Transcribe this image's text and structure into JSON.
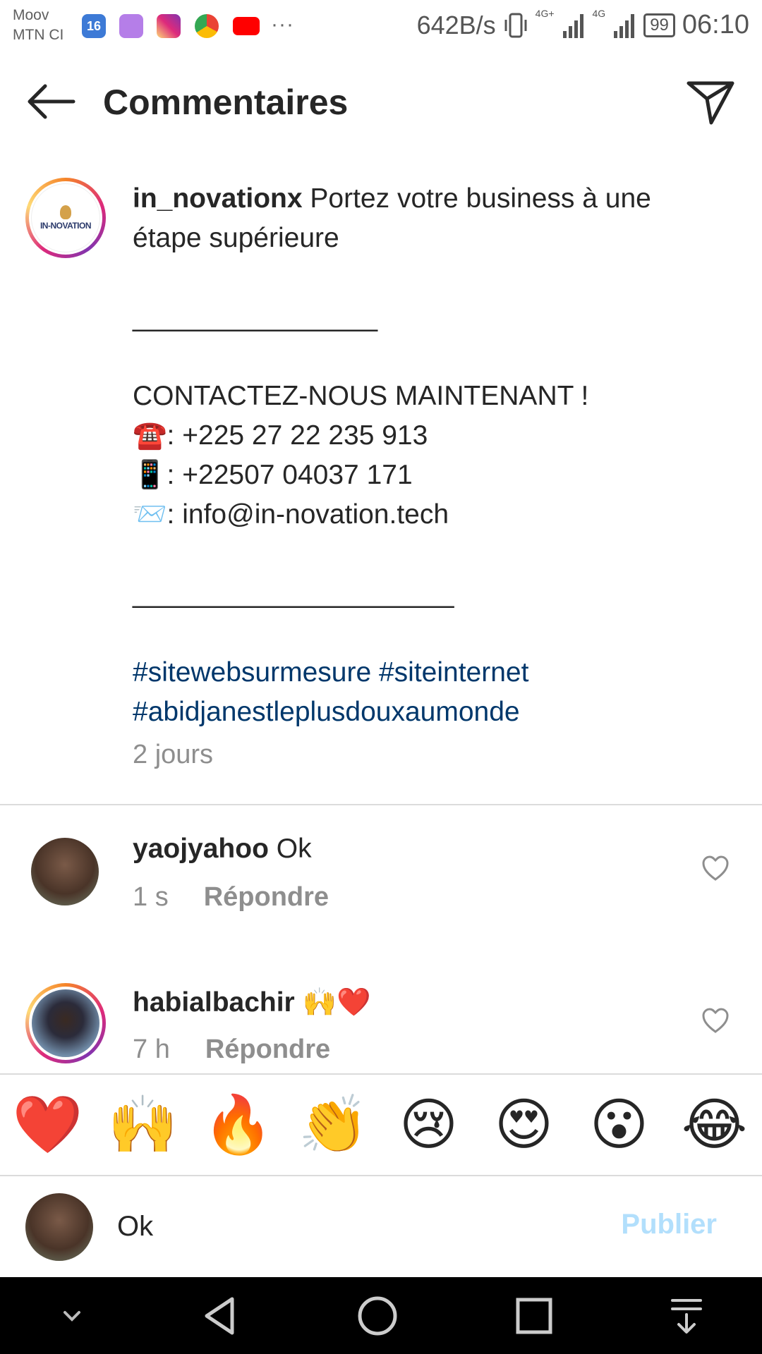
{
  "status_bar": {
    "carrier_1": "Moov",
    "carrier_2": "MTN CI",
    "notif_badge": "16",
    "overflow": "···",
    "speed": "642B/s",
    "net_1": "4G+",
    "net_2": "4G",
    "battery": "99",
    "time": "06:10"
  },
  "header": {
    "title": "Commentaires",
    "back_icon": "arrow-left-icon",
    "share_icon": "paper-plane-icon"
  },
  "post": {
    "username": "in_novationx",
    "avatar_text": "IN-NOVATION",
    "caption_lines": [
      "Portez votre business à une",
      "étape supérieure",
      "",
      "________________",
      "",
      "CONTACTEZ-NOUS MAINTENANT !",
      "☎️: +225 27 22 235 913",
      "📱: +22507 04037 171",
      "📨: info@in-novation.tech",
      "",
      "_____________________",
      ""
    ],
    "hashtags_line1": "#sitewebsurmesure #siteinternet",
    "hashtags_line2": "#abidjanestleplusdouxaumonde",
    "time": "2 jours"
  },
  "comments": [
    {
      "username": "yaojyahoo",
      "text": "Ok",
      "time": "1 s",
      "reply": "Répondre"
    },
    {
      "username": "habialbachir",
      "text": "🙌❤️",
      "time": "7 h",
      "reply": "Répondre"
    }
  ],
  "emoji_bar": [
    "❤️",
    "🙌",
    "🔥",
    "👏",
    "😢",
    "😍",
    "😮",
    "😂"
  ],
  "composer": {
    "value": "Ok",
    "publish_label": "Publier"
  },
  "colors": {
    "hashtag": "#00376b",
    "muted": "#8e8e8e",
    "publish_disabled": "#b2dffc"
  }
}
